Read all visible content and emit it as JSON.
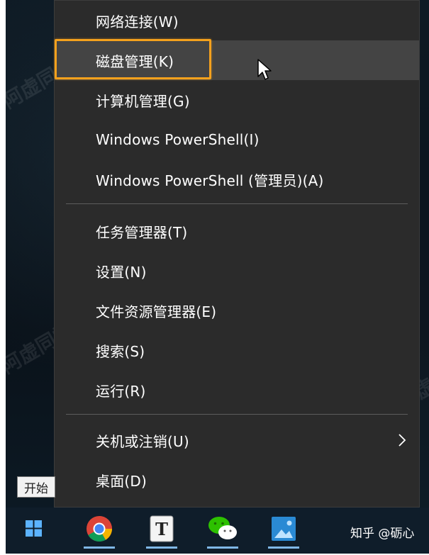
{
  "menu": {
    "items": [
      {
        "label": "网络连接(W)"
      },
      {
        "label": "磁盘管理(K)"
      },
      {
        "label": "计算机管理(G)"
      },
      {
        "label": "Windows PowerShell(I)"
      },
      {
        "label": "Windows PowerShell (管理员)(A)"
      },
      {
        "label": "任务管理器(T)"
      },
      {
        "label": "设置(N)"
      },
      {
        "label": "文件资源管理器(E)"
      },
      {
        "label": "搜索(S)"
      },
      {
        "label": "运行(R)"
      },
      {
        "label": "关机或注销(U)"
      },
      {
        "label": "桌面(D)"
      }
    ]
  },
  "tooltip": {
    "label": "开始"
  },
  "taskbar": {
    "apps": [
      {
        "icon": "chrome-icon"
      },
      {
        "icon": "typora-icon",
        "glyph": "T"
      },
      {
        "icon": "wechat-icon"
      },
      {
        "icon": "photos-icon"
      }
    ]
  },
  "watermark": {
    "text": "公众号：阿虚同学",
    "short": "阿虚同学"
  },
  "brand": {
    "text": "知乎 @砺心"
  },
  "colors": {
    "menu_bg": "#2b2b2b",
    "hover_bg": "#444444",
    "highlight": "#f4a11d",
    "taskbar_bg": "#0f1d2a"
  }
}
